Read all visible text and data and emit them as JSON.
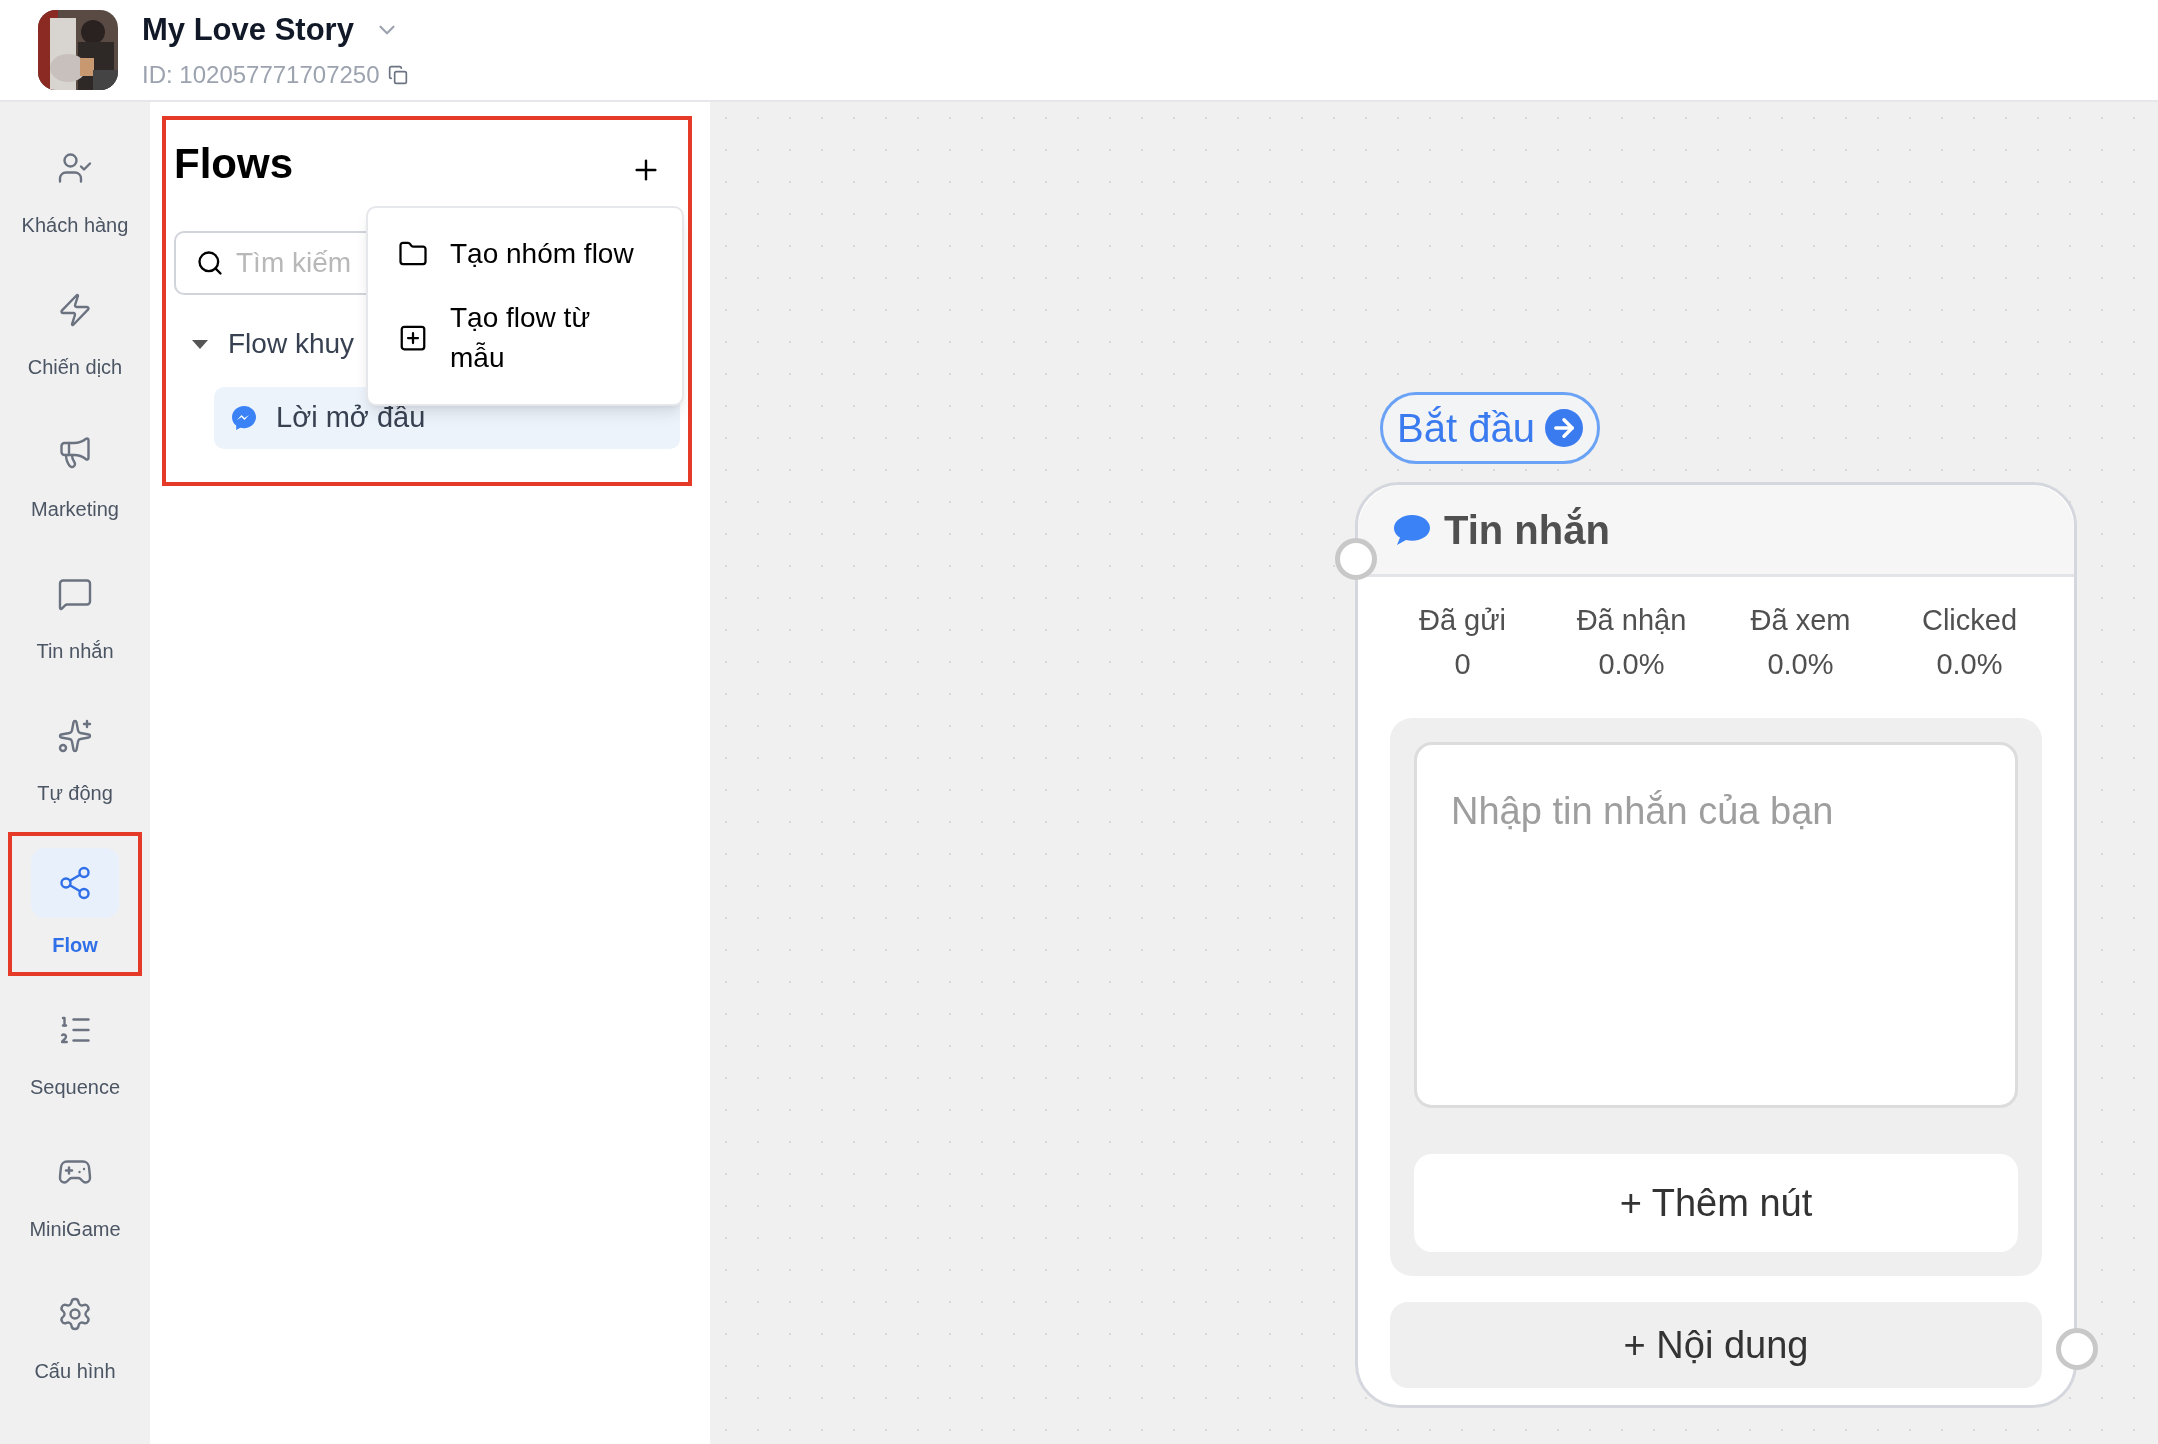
{
  "header": {
    "page_name": "My Love Story",
    "page_id": "ID: 102057771707250"
  },
  "sidebar": {
    "items": [
      {
        "label": "Khách hàng",
        "selected": false,
        "highlighted": false
      },
      {
        "label": "Chiến dịch",
        "selected": false,
        "highlighted": false
      },
      {
        "label": "Marketing",
        "selected": false,
        "highlighted": false
      },
      {
        "label": "Tin nhắn",
        "selected": false,
        "highlighted": false
      },
      {
        "label": "Tự động",
        "selected": false,
        "highlighted": false
      },
      {
        "label": "Flow",
        "selected": true,
        "highlighted": true
      },
      {
        "label": "Sequence",
        "selected": false,
        "highlighted": false
      },
      {
        "label": "MiniGame",
        "selected": false,
        "highlighted": false
      },
      {
        "label": "Cấu hình",
        "selected": false,
        "highlighted": false
      }
    ]
  },
  "flows_panel": {
    "title": "Flows",
    "highlighted": true,
    "search": {
      "placeholder": "Tìm kiếm"
    },
    "groups": [
      {
        "label": "Flow khuy",
        "expanded": true,
        "children": [
          {
            "label": "Lời mở đầu",
            "selected": true
          }
        ]
      }
    ],
    "menu": [
      {
        "label": "Tạo nhóm flow"
      },
      {
        "label": "Tạo flow từ mẫu"
      }
    ]
  },
  "canvas": {
    "start_label": "Bắt đầu",
    "node": {
      "title": "Tin nhắn",
      "stats": [
        {
          "label": "Đã gửi",
          "value": "0"
        },
        {
          "label": "Đã nhận",
          "value": "0.0%"
        },
        {
          "label": "Đã xem",
          "value": "0.0%"
        },
        {
          "label": "Clicked",
          "value": "0.0%"
        }
      ],
      "message": {
        "placeholder": "Nhập tin nhắn của bạn"
      },
      "add_button": "+ Thêm nút",
      "add_content": "+ Nội dung"
    }
  }
}
